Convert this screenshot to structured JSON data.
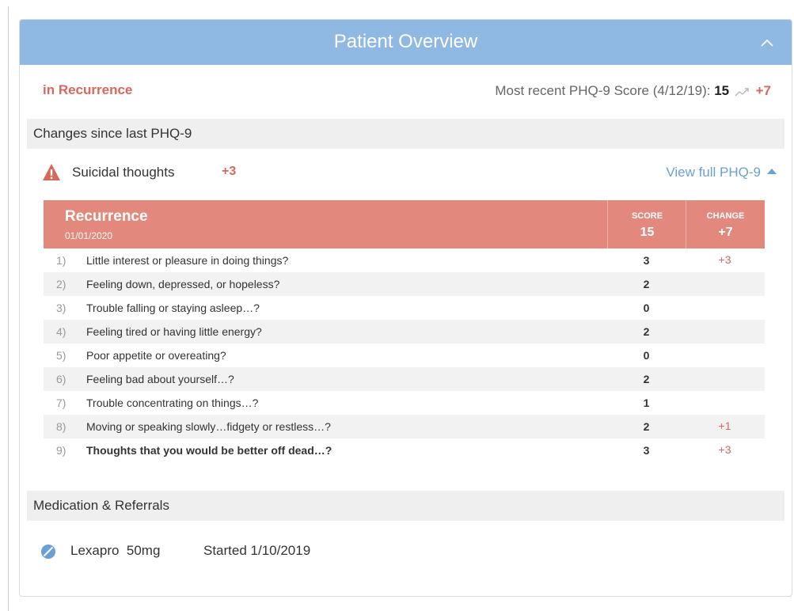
{
  "header": {
    "title": "Patient Overview"
  },
  "status": {
    "label": "in Recurrence",
    "recent_label": "Most recent PHQ-9 Score (4/12/19):",
    "recent_score": "15",
    "recent_change": "+7"
  },
  "changes": {
    "section_title": "Changes since last PHQ-9",
    "alert_label": "Suicidal thoughts",
    "alert_change": "+3",
    "view_link": "View full PHQ-9"
  },
  "table": {
    "title": "Recurrence",
    "date": "01/01/2020",
    "score_header": "SCORE",
    "score_total": "15",
    "change_header": "CHANGE",
    "change_total": "+7",
    "rows": [
      {
        "num": "1)",
        "question": "Little interest or pleasure in doing things?",
        "score": "3",
        "change": "+3"
      },
      {
        "num": "2)",
        "question": "Feeling down, depressed, or hopeless?",
        "score": "2",
        "change": ""
      },
      {
        "num": "3)",
        "question": "Trouble falling or staying asleep…?",
        "score": "0",
        "change": ""
      },
      {
        "num": "4)",
        "question": "Feeling tired or having little energy?",
        "score": "2",
        "change": ""
      },
      {
        "num": "5)",
        "question": "Poor appetite or overeating?",
        "score": "0",
        "change": ""
      },
      {
        "num": "6)",
        "question": "Feeling bad about yourself…?",
        "score": "2",
        "change": ""
      },
      {
        "num": "7)",
        "question": "Trouble concentrating on things…?",
        "score": "1",
        "change": ""
      },
      {
        "num": "8)",
        "question": "Moving or speaking slowly…fidgety or restless…?",
        "score": "2",
        "change": "+1"
      },
      {
        "num": "9)",
        "question": "Thoughts that you would be better off dead…?",
        "score": "3",
        "change": "+3"
      }
    ]
  },
  "medications": {
    "section_title": "Medication & Referrals",
    "items": [
      {
        "name": "Lexapro  50mg",
        "started": "Started 1/10/2019",
        "icon": "pill-icon"
      }
    ]
  },
  "colors": {
    "header_blue": "#8fb8e3",
    "alert_red": "#d9685a",
    "table_header": "#e3887c",
    "link_blue": "#6aa0d6"
  }
}
